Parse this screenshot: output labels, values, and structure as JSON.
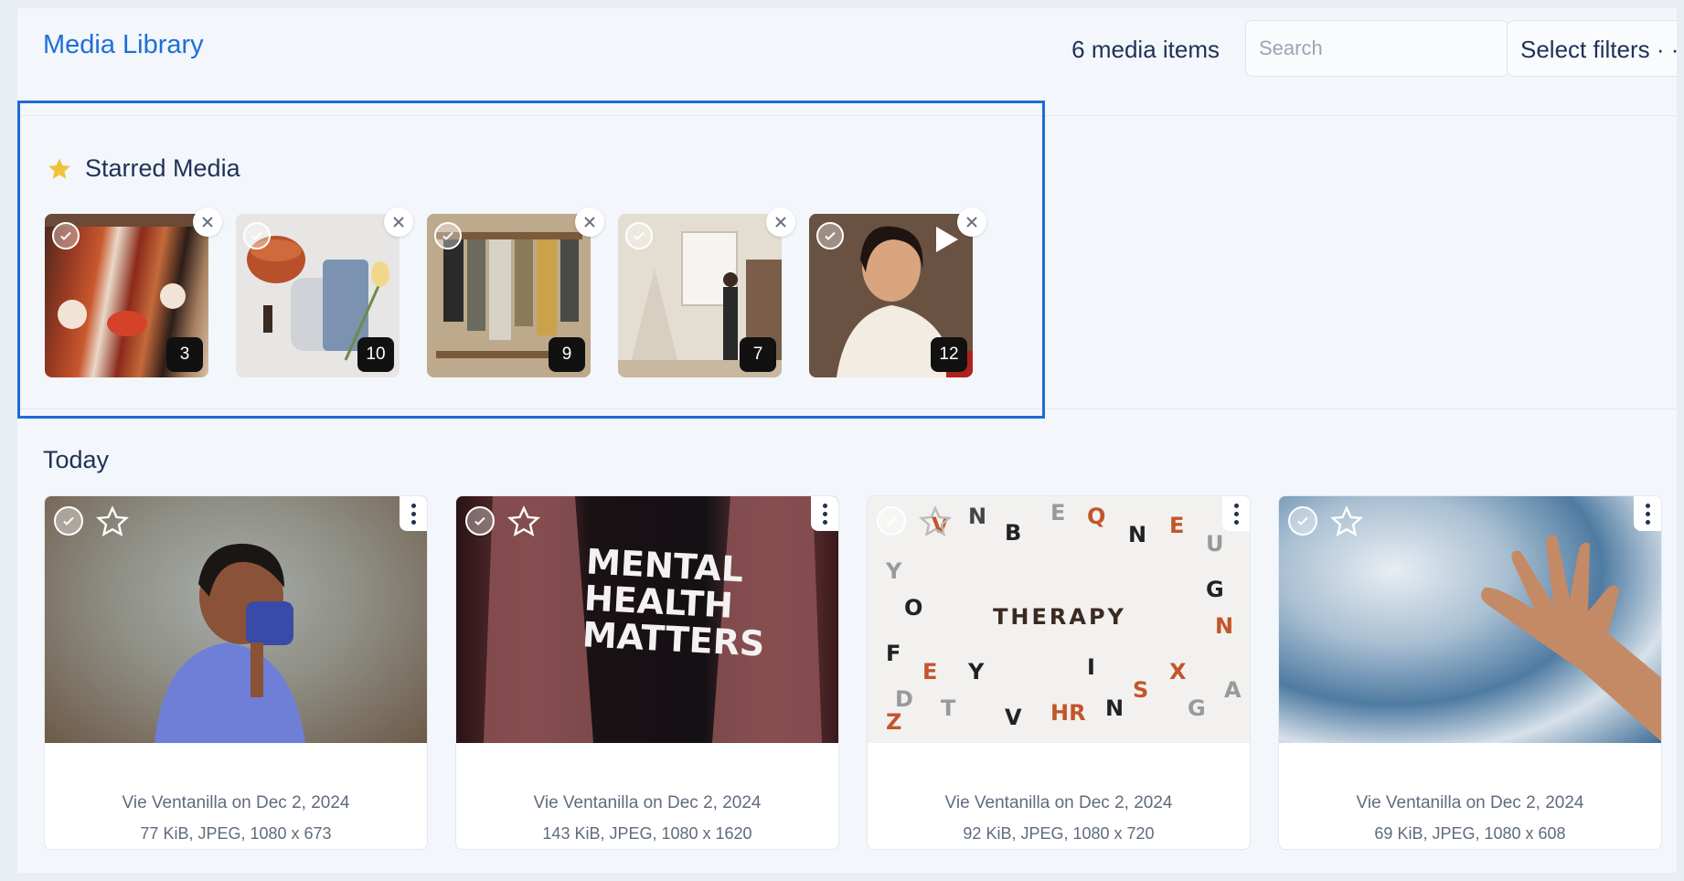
{
  "header": {
    "title": "Media Library",
    "count_label": "6 media items",
    "search_placeholder": "Search",
    "filters_label": "Select filters · ·"
  },
  "starred": {
    "title": "Starred Media",
    "items": [
      {
        "badge": "3",
        "video": false
      },
      {
        "badge": "10",
        "video": false
      },
      {
        "badge": "9",
        "video": false
      },
      {
        "badge": "7",
        "video": false
      },
      {
        "badge": "12",
        "video": true
      }
    ]
  },
  "today": {
    "title": "Today",
    "items": [
      {
        "author_date": "Vie Ventanilla on Dec 2, 2024",
        "details": "77 KiB, JPEG, 1080 x 673"
      },
      {
        "author_date": "Vie Ventanilla on Dec 2, 2024",
        "details": "143 KiB, JPEG, 1080 x 1620"
      },
      {
        "author_date": "Vie Ventanilla on Dec 2, 2024",
        "details": "92 KiB, JPEG, 1080 x 720"
      },
      {
        "author_date": "Vie Ventanilla on Dec 2, 2024",
        "details": "69 KiB, JPEG, 1080 x 608"
      }
    ]
  },
  "images": {
    "img_text_2": "MENTAL HEALTH MATTERS",
    "img_text_3": "THERAPY"
  },
  "colors": {
    "accent": "#1e6fd9",
    "selection_border": "#1f6bd6",
    "star": "#f0c23a",
    "text": "#1f3156"
  }
}
